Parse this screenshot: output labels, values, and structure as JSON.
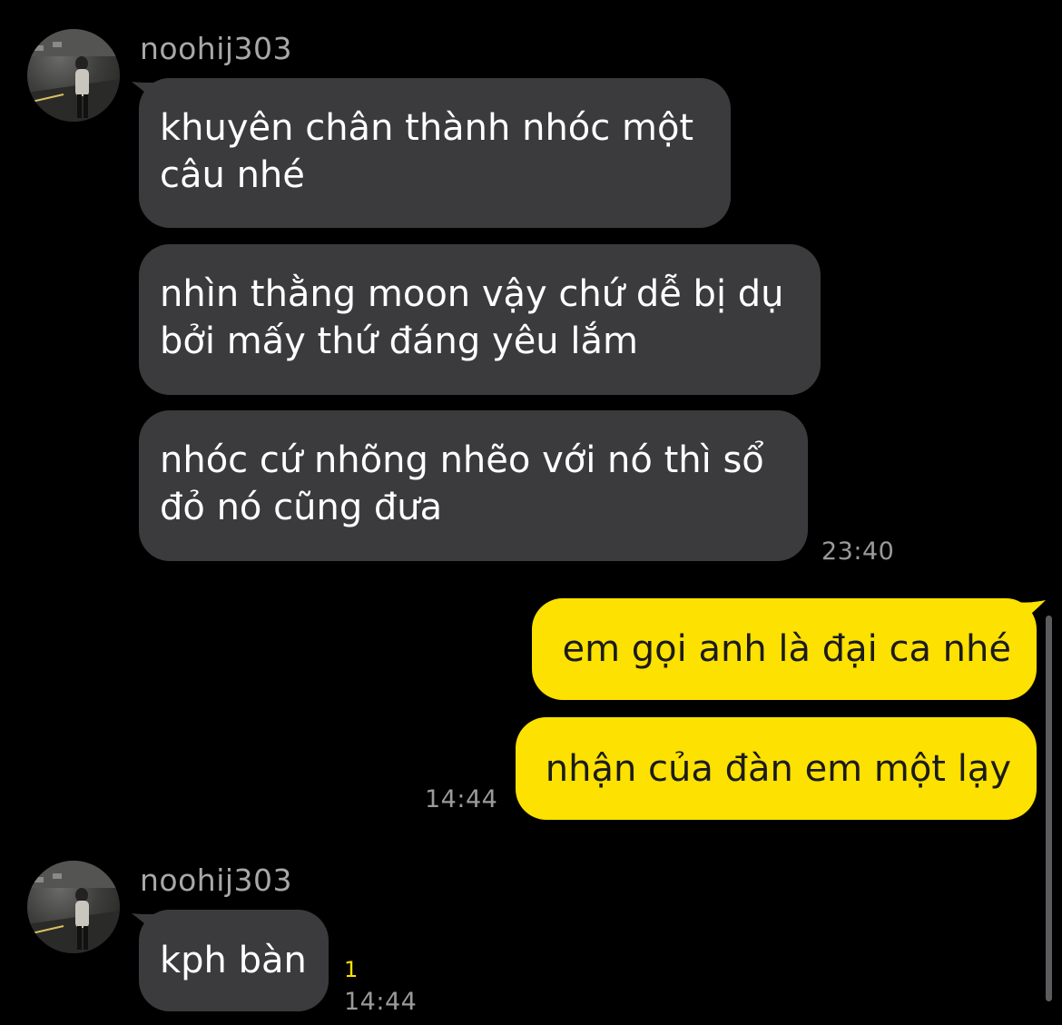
{
  "conversation": {
    "group1": {
      "sender": "noohij303",
      "messages": [
        "khuyên chân thành nhóc một\ncâu nhé",
        "nhìn thằng moon vậy chứ dễ bị dụ\nbởi mấy thứ đáng yêu lắm",
        "nhóc cứ nhõng nhẽo với nó thì sổ\nđỏ nó cũng đưa"
      ],
      "time": "23:40"
    },
    "group2": {
      "messages": [
        "em gọi anh là đại ca nhé",
        "nhận của đàn em một lạy"
      ],
      "time": "14:44"
    },
    "group3": {
      "sender": "noohij303",
      "messages": [
        "kph bàn"
      ],
      "unread_count": "1",
      "time": "14:44"
    }
  },
  "colors": {
    "background": "#000000",
    "incoming_bubble": "#3b3b3d",
    "outgoing_bubble": "#fde100",
    "timestamp": "#9a9a9a"
  }
}
